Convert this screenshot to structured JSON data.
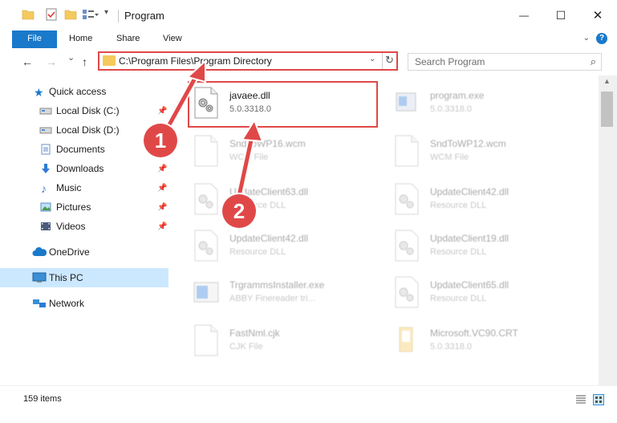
{
  "window": {
    "title": "Program",
    "controls": {
      "minimize": "—",
      "maximize": "☐",
      "close": "✕"
    }
  },
  "ribbon": {
    "tabs": [
      "File",
      "Home",
      "Share",
      "View"
    ],
    "help": "?"
  },
  "navigation": {
    "back": "←",
    "forward": "→",
    "recent": "⌄",
    "up": "↑",
    "address_path": "C:\\Program Files\\Program Directory",
    "search_placeholder": "Search Program"
  },
  "sidebar": {
    "items": [
      {
        "label": "Quick access",
        "icon": "star-icon",
        "pinned": false
      },
      {
        "label": "Local Disk (C:)",
        "icon": "drive-icon",
        "pinned": true
      },
      {
        "label": "Local Disk (D:)",
        "icon": "drive-icon",
        "pinned": false
      },
      {
        "label": "Documents",
        "icon": "documents-icon",
        "pinned": true
      },
      {
        "label": "Downloads",
        "icon": "download-icon",
        "pinned": true
      },
      {
        "label": "Music",
        "icon": "music-icon",
        "pinned": true
      },
      {
        "label": "Pictures",
        "icon": "pictures-icon",
        "pinned": true
      },
      {
        "label": "Videos",
        "icon": "videos-icon",
        "pinned": true
      },
      {
        "label": "OneDrive",
        "icon": "cloud-icon",
        "pinned": false
      },
      {
        "label": "This PC",
        "icon": "computer-icon",
        "pinned": false,
        "selected": true
      },
      {
        "label": "Network",
        "icon": "network-icon",
        "pinned": false
      }
    ]
  },
  "files": [
    {
      "name": "javaee.dll",
      "sub": "5.0.3318.0",
      "icon": "dll-gear-icon",
      "highlighted": true
    },
    {
      "name": "program.exe",
      "sub": "5.0.3318.0",
      "icon": "exe-icon"
    },
    {
      "name": "SndToWP16.wcm",
      "sub": "WCM File",
      "icon": "blank-file-icon"
    },
    {
      "name": "SndToWP12.wcm",
      "sub": "WCM File",
      "icon": "blank-file-icon"
    },
    {
      "name": "UpdateClient63.dll",
      "sub": "Resource DLL",
      "icon": "dll-gear-icon"
    },
    {
      "name": "UpdateClient42.dll",
      "sub": "Resource DLL",
      "icon": "dll-gear-icon"
    },
    {
      "name": "UpdateClient42.dll",
      "sub": "Resource DLL",
      "icon": "dll-gear-icon"
    },
    {
      "name": "UpdateClient19.dll",
      "sub": "Resource DLL",
      "icon": "dll-gear-icon"
    },
    {
      "name": "TrgrammsInstaller.exe",
      "sub": "ABBY Finereader tri...",
      "icon": "installer-icon"
    },
    {
      "name": "UpdateClient65.dll",
      "sub": "Resource DLL",
      "icon": "dll-gear-icon"
    },
    {
      "name": "FastNml.cjk",
      "sub": "CJK File",
      "icon": "blank-file-icon"
    },
    {
      "name": "Microsoft.VC90.CRT",
      "sub": "5.0.3318.0",
      "icon": "folder-doc-icon"
    }
  ],
  "status": {
    "item_count": "159 items"
  },
  "annotations": {
    "step1": "1",
    "step2": "2",
    "color": "#e04848"
  }
}
